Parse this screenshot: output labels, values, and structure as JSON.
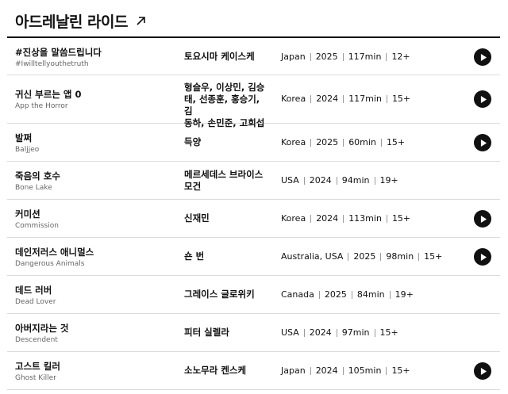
{
  "header": {
    "title": "아드레날린 라이드",
    "arrow_icon": "arrow-up-right-icon"
  },
  "rows": [
    {
      "title_ko": "#진상을 말씀드립니다",
      "title_en": "#Iwilltellyouthetruth",
      "director": [
        "토요시마 케이스케"
      ],
      "country": "Japan",
      "year": "2025",
      "runtime": "117min",
      "rating": "12+",
      "play": true
    },
    {
      "title_ko": "귀신 부르는 앱 0",
      "title_en": "App the Horror",
      "director": [
        "형슬우, 이상민, 김승",
        "태, 선종훈, 홍승기, 김",
        "동하, 손민준, 고희섭"
      ],
      "country": "Korea",
      "year": "2024",
      "runtime": "117min",
      "rating": "15+",
      "play": true
    },
    {
      "title_ko": "발쩌",
      "title_en": "Baljjeo",
      "director": [
        "득양"
      ],
      "country": "Korea",
      "year": "2025",
      "runtime": "60min",
      "rating": "15+",
      "play": true
    },
    {
      "title_ko": "죽음의 호수",
      "title_en": "Bone Lake",
      "director": [
        "메르세데스 브라이스",
        "모건"
      ],
      "country": "USA",
      "year": "2024",
      "runtime": "94min",
      "rating": "19+",
      "play": false
    },
    {
      "title_ko": "커미션",
      "title_en": "Commission",
      "director": [
        "신재민"
      ],
      "country": "Korea",
      "year": "2024",
      "runtime": "113min",
      "rating": "15+",
      "play": true
    },
    {
      "title_ko": "데인저러스 애니멀스",
      "title_en": "Dangerous Animals",
      "director": [
        "숀 번"
      ],
      "country": "Australia, USA",
      "year": "2025",
      "runtime": "98min",
      "rating": "15+",
      "play": true
    },
    {
      "title_ko": "데드 러버",
      "title_en": "Dead Lover",
      "director": [
        "그레이스 글로위키"
      ],
      "country": "Canada",
      "year": "2025",
      "runtime": "84min",
      "rating": "19+",
      "play": false
    },
    {
      "title_ko": "아버지라는 것",
      "title_en": "Descendent",
      "director": [
        "피터 실렐라"
      ],
      "country": "USA",
      "year": "2024",
      "runtime": "97min",
      "rating": "15+",
      "play": false
    },
    {
      "title_ko": "고스트 킬러",
      "title_en": "Ghost Killer",
      "director": [
        "소노무라 켄스케"
      ],
      "country": "Japan",
      "year": "2024",
      "runtime": "105min",
      "rating": "15+",
      "play": true
    }
  ]
}
